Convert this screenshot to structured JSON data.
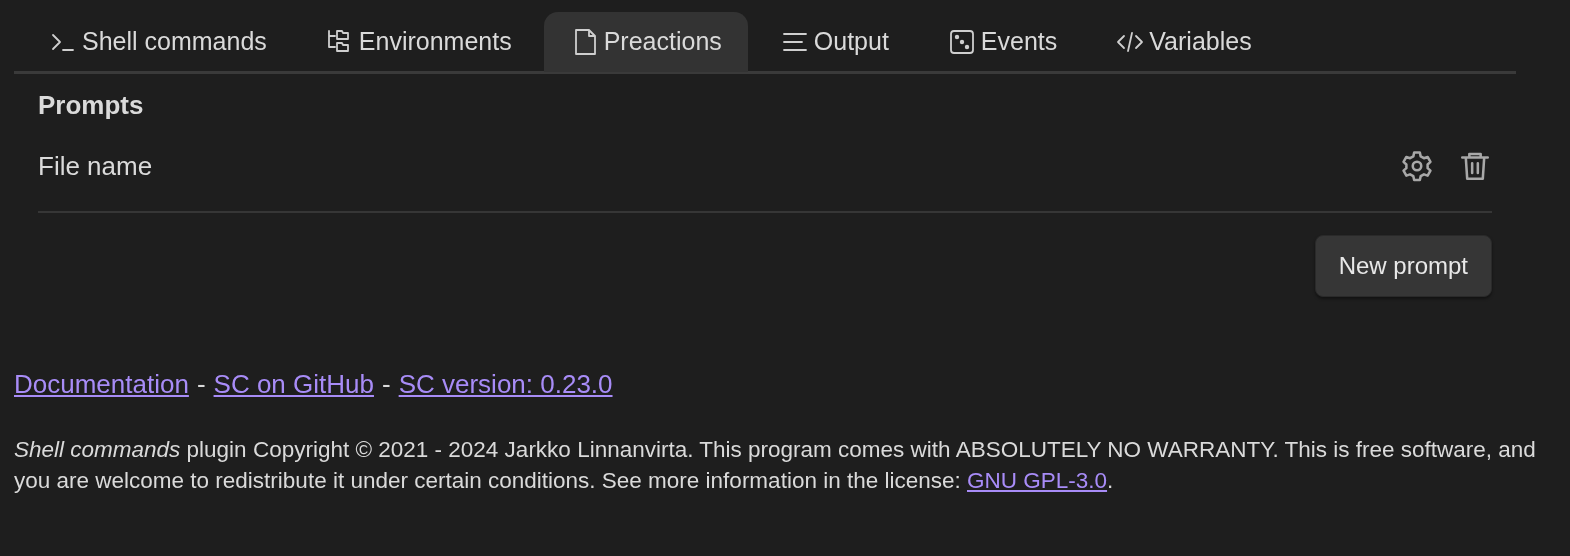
{
  "tabs": [
    {
      "label": "Shell commands",
      "kind": "shell",
      "selected": false
    },
    {
      "label": "Environments",
      "kind": "tree",
      "selected": false
    },
    {
      "label": "Preactions",
      "kind": "file",
      "selected": true
    },
    {
      "label": "Output",
      "kind": "lines",
      "selected": false
    },
    {
      "label": "Events",
      "kind": "dice",
      "selected": false
    },
    {
      "label": "Variables",
      "kind": "code",
      "selected": false
    }
  ],
  "section": {
    "title": "Prompts",
    "items": [
      {
        "name": "File name"
      }
    ],
    "button": "New prompt"
  },
  "links": [
    {
      "kind": "link",
      "text": "Documentation"
    },
    {
      "kind": "sep",
      "text": "-"
    },
    {
      "kind": "link",
      "text": "SC on GitHub"
    },
    {
      "kind": "sep",
      "text": "-"
    },
    {
      "kind": "link",
      "text": "SC version: 0.23.0"
    }
  ],
  "license": {
    "before": "*Shell commands* plugin Copyright © 2021 - 2024 Jarkko Linnanvirta. This program comes with ABSOLUTELY NO WARRANTY. This is free software, and you are welcome to redistribute it under certain conditions. See more information in the license: ",
    "link": "GNU GPL-3.0",
    "after": "."
  }
}
